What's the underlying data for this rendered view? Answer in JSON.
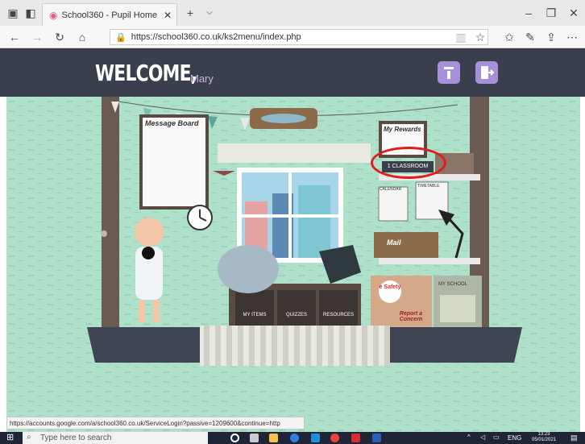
{
  "browser": {
    "tab_title": "School360 - Pupil Home",
    "url": "https://school360.co.uk/ks2menu/index.php",
    "status_url": "https://accounts.google.com/a/school360.co.uk/ServiceLogin?passive=1209600&continue=http"
  },
  "header": {
    "welcome": "WELCOME",
    "comma": ",",
    "user_name": "Mary"
  },
  "room": {
    "message_board": "Message Board",
    "my_rewards": "My Rewards",
    "classroom": "1 CLASSROOM",
    "calendar": "CALENDAR",
    "timetable": "TIMETABLE",
    "mail": "Mail",
    "e_safety": "e Safety",
    "report_a_concern": "Report a Concern",
    "my_school": "MY SCHOOL",
    "drawers": [
      "MY ITEMS",
      "QUIZZES",
      "RESOURCES"
    ]
  },
  "taskbar": {
    "search_placeholder": "Type here to search",
    "lang": "ENG",
    "time": "13:23",
    "date": "05/01/2021"
  },
  "colors": {
    "header_bg": "#3a3f4e",
    "scene_bg": "#aee0ca",
    "accent_purple": "#a88fdc",
    "highlight_red": "#e31b1b"
  }
}
